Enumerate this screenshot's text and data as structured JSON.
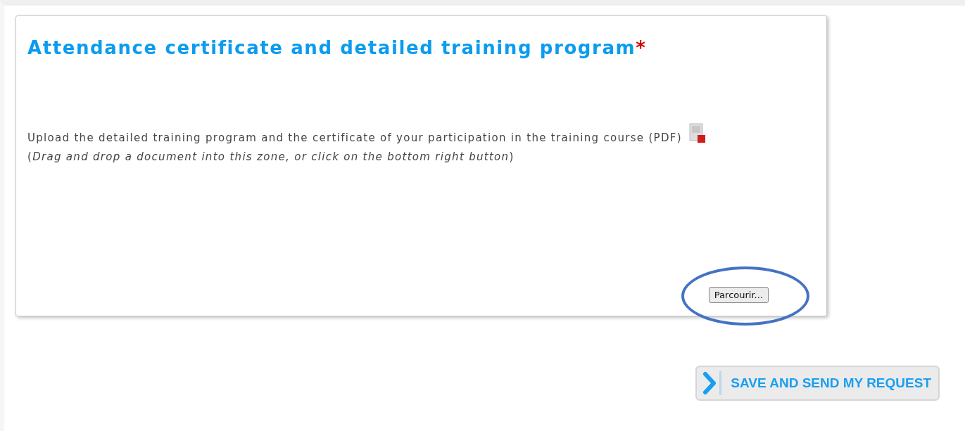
{
  "upload_panel": {
    "title": "Attendance certificate and detailed training program",
    "required_mark": "*",
    "description": "Upload the detailed training program and the certificate of your participation in the training course (PDF)",
    "hint": "(*Drag and drop a document into this zone, or click on the bottom right button*)",
    "browse_button": "Parcourir...",
    "browse_highlighted": true
  },
  "submit_button": "SAVE AND SEND MY REQUEST"
}
